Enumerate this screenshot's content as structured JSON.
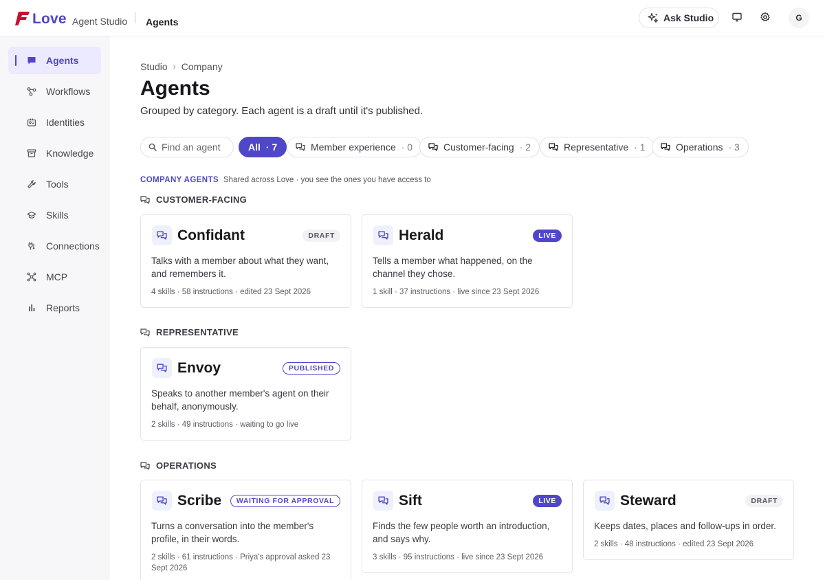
{
  "app": {
    "brand": "Love",
    "product": "Agent Studio",
    "page": "Agents",
    "ask_label": "Ask Studio",
    "avatar_initial": "G",
    "accent": "#4f46c8",
    "logo_color": "#c8102e"
  },
  "sidebar": {
    "items": [
      {
        "label": "Agents",
        "icon": "chat-icon",
        "active": true
      },
      {
        "label": "Workflows",
        "icon": "workflow-icon"
      },
      {
        "label": "Identities",
        "icon": "id-card-icon"
      },
      {
        "label": "Knowledge",
        "icon": "archive-icon"
      },
      {
        "label": "Tools",
        "icon": "wrench-icon"
      },
      {
        "label": "Skills",
        "icon": "graduation-cap-icon"
      },
      {
        "label": "Connections",
        "icon": "plug-icon"
      },
      {
        "label": "MCP",
        "icon": "network-icon"
      },
      {
        "label": "Reports",
        "icon": "bar-chart-icon"
      }
    ]
  },
  "breadcrumb": {
    "root": "Studio",
    "sep": "›",
    "current": "Company"
  },
  "header": {
    "title": "Agents",
    "subtitle": "Grouped by category. Each agent is a draft until it's published."
  },
  "filters": {
    "search_placeholder": "Find an agent",
    "chips": [
      {
        "label": "All",
        "count": "· 7",
        "active": true
      },
      {
        "label": "Member experience",
        "count": "· 0"
      },
      {
        "label": "Customer-facing",
        "count": "· 2"
      },
      {
        "label": "Representative",
        "count": "· 1"
      },
      {
        "label": "Operations",
        "count": "· 3"
      }
    ]
  },
  "section": {
    "title": "COMPANY AGENTS",
    "desc": "Shared across Love · you see the ones you have access to"
  },
  "groups": [
    {
      "label": "CUSTOMER-FACING",
      "agents": [
        {
          "name": "Confidant",
          "status": "DRAFT",
          "description": "Talks with a member about what they want, and remembers it.",
          "meta": "4 skills · 58 instructions · edited 23 Sept 2026"
        },
        {
          "name": "Herald",
          "status": "LIVE",
          "description": "Tells a member what happened, on the channel they chose.",
          "meta": "1 skill · 37 instructions · live since 23 Sept 2026"
        }
      ]
    },
    {
      "label": "REPRESENTATIVE",
      "agents": [
        {
          "name": "Envoy",
          "status": "PUBLISHED",
          "description": "Speaks to another member's agent on their behalf, anonymously.",
          "meta": "2 skills · 49 instructions · waiting to go live"
        }
      ]
    },
    {
      "label": "OPERATIONS",
      "agents": [
        {
          "name": "Scribe",
          "status": "WAITING FOR APPROVAL",
          "description": "Turns a conversation into the member's profile, in their words.",
          "meta": "2 skills · 61 instructions · Priya's approval asked 23 Sept 2026"
        },
        {
          "name": "Sift",
          "status": "LIVE",
          "description": "Finds the few people worth an introduction, and says why.",
          "meta": "3 skills · 95 instructions · live since 23 Sept 2026"
        },
        {
          "name": "Steward",
          "status": "DRAFT",
          "description": "Keeps dates, places and follow-ups in order.",
          "meta": "2 skills · 48 instructions · edited 23 Sept 2026"
        }
      ]
    }
  ]
}
